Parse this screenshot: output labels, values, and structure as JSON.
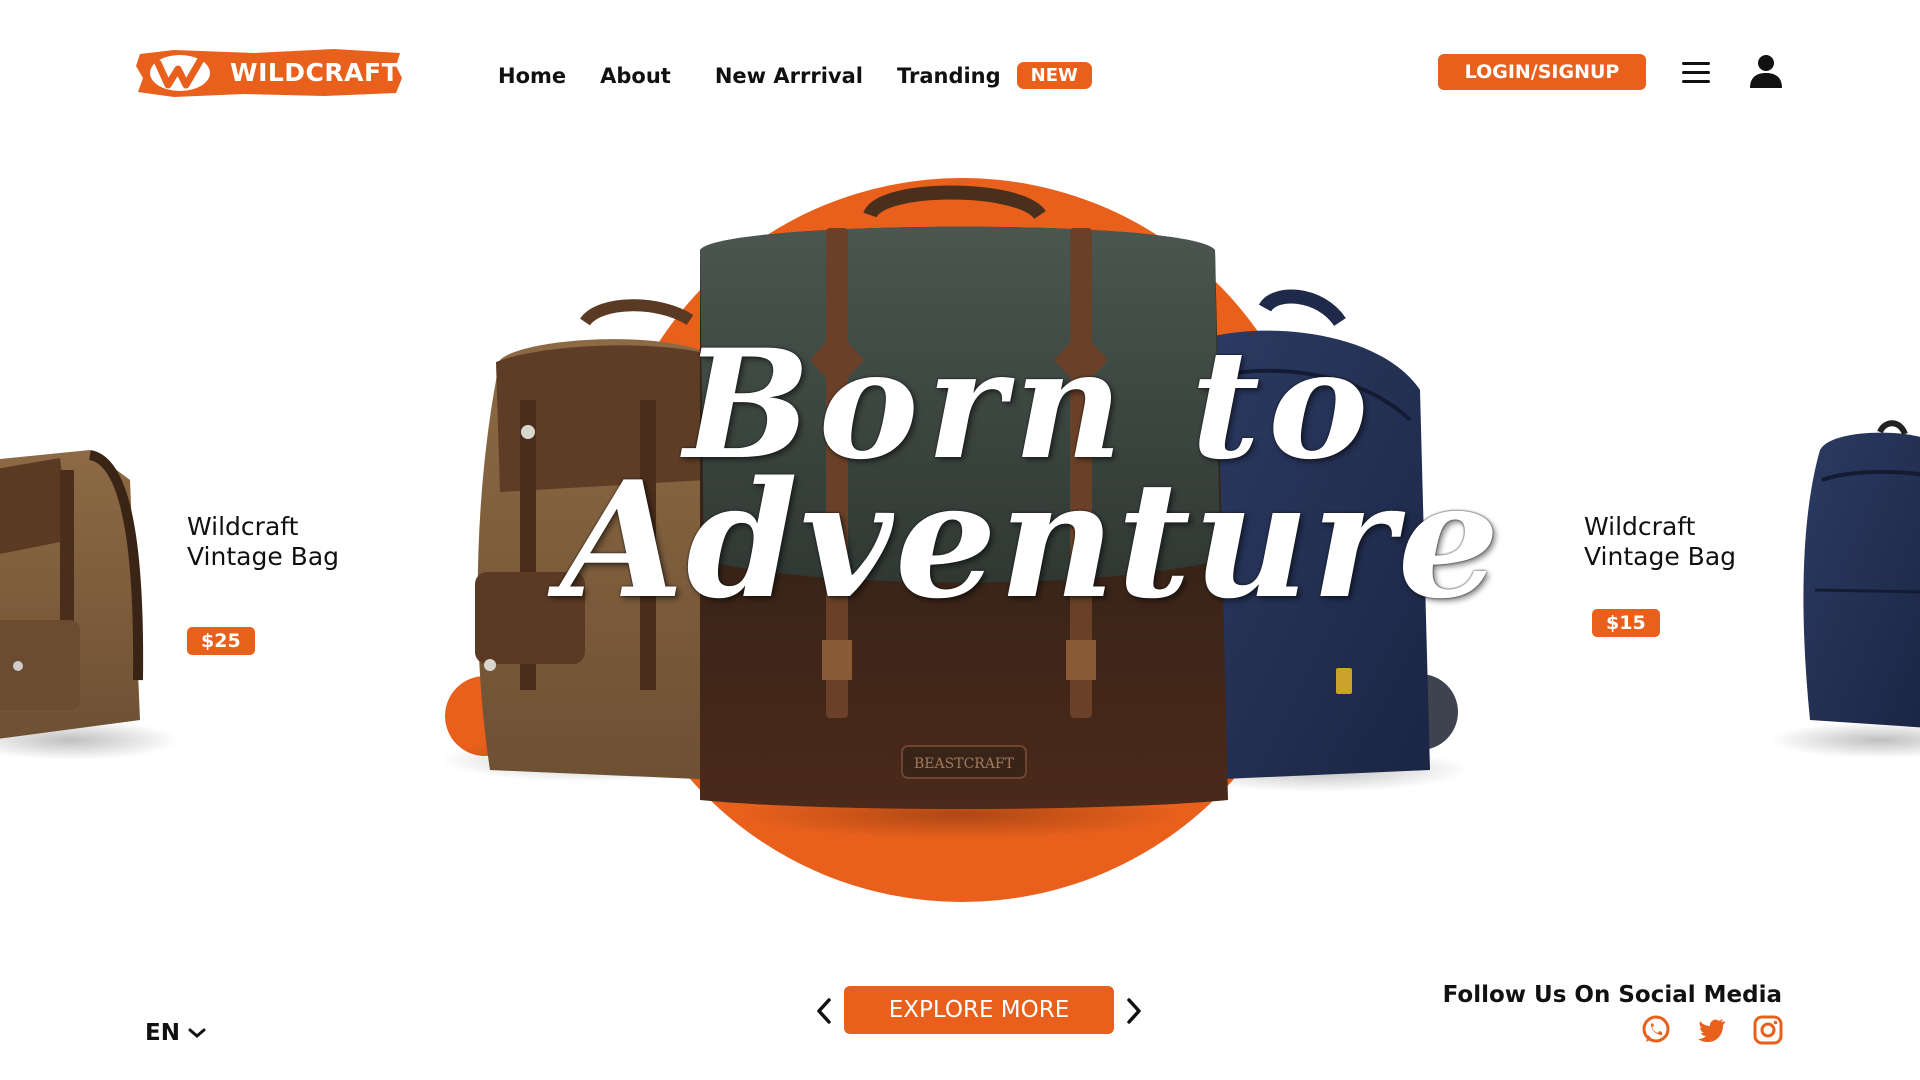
{
  "brand": {
    "logo_text": "WILDCRAFT",
    "accent_color": "#e8601c",
    "text_color": "#111111"
  },
  "nav": {
    "items": [
      {
        "label": "Home"
      },
      {
        "label": "About"
      },
      {
        "label": "New Arrrival"
      },
      {
        "label": "Tranding"
      }
    ],
    "badge": "NEW"
  },
  "header": {
    "login_label": "LOGIN/SIGNUP",
    "menu_icon": "hamburger-menu-icon",
    "user_icon": "user-icon"
  },
  "hero": {
    "headline_line1": "Born to",
    "headline_line2": "Adventure",
    "bag_label": "BEASTCRAFT"
  },
  "products": {
    "left": {
      "name_line1": "Wildcraft",
      "name_line2": "Vintage Bag",
      "price": "$25"
    },
    "right": {
      "name_line1": "Wildcraft",
      "name_line2": "Vintage Bag",
      "price": "$15"
    }
  },
  "footer": {
    "language": "EN",
    "explore_label": "EXPLORE MORE",
    "follow_label": "Follow Us On Social Media",
    "social_icons": [
      "whatsapp-icon",
      "twitter-icon",
      "instagram-icon"
    ]
  }
}
